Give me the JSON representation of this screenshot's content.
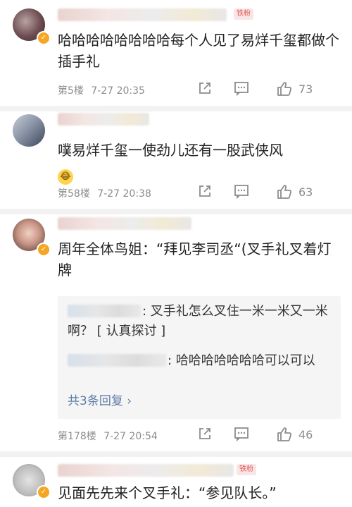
{
  "comments": [
    {
      "badge": "铁粉",
      "text": "哈哈哈哈哈哈哈哈每个人见了易烊千玺都做个插手礼",
      "floor": "第5楼",
      "time": "7-27 20:35",
      "likes": "73",
      "verified_mark": "✓"
    },
    {
      "badge": "",
      "text": "噗易烊千玺一使劲儿还有一股武侠风",
      "emoji": "😂",
      "floor": "第58楼",
      "time": "7-27 20:38",
      "likes": "63"
    },
    {
      "badge": "",
      "text": "周年全体鸟姐：“拜见李司丞“(叉手礼叉着灯牌",
      "floor": "第178楼",
      "time": "7-27 20:54",
      "likes": "46",
      "verified_mark": "✓",
      "replies": [
        {
          "text": ": 叉手礼怎么叉住一米一米又一米啊？ [ 认真探讨 ]"
        },
        {
          "text": ": 哈哈哈哈哈哈哈可以可以"
        }
      ],
      "more_replies": "共3条回复 ›"
    },
    {
      "badge": "铁粉",
      "text": "见面先先来个叉手礼：“参见队长。”",
      "verified_mark": "✓"
    }
  ],
  "icons": {
    "share": "share-icon",
    "comment": "comment-icon",
    "like": "thumbs-up-icon"
  },
  "colors": {
    "link": "#5d7da6",
    "meta": "#8c8c8c",
    "vip": "#f5a623"
  }
}
